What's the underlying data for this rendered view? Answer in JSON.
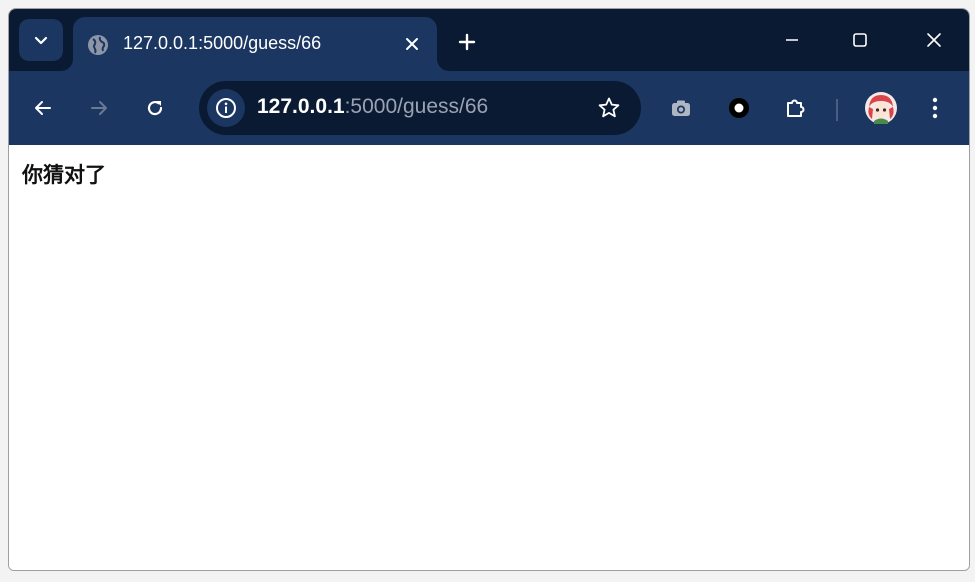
{
  "browser": {
    "tab": {
      "title": "127.0.0.1:5000/guess/66",
      "favicon": "globe-icon"
    },
    "window_controls": [
      "minimize-icon",
      "maximize-icon",
      "close-icon"
    ],
    "address_bar": {
      "host": "127.0.0.1",
      "path": ":5000/guess/66"
    },
    "toolbar_icons": [
      "back-icon",
      "forward-icon",
      "reload-icon",
      "site-info-icon",
      "bookmark-star-icon",
      "camera-extension-icon",
      "circle-extension-icon",
      "extensions-puzzle-icon",
      "profile-avatar",
      "more-menu-icon"
    ],
    "colors": {
      "titlebar": "#0b1a33",
      "toolbar": "#1b3660",
      "omnibox": "#0b1a33"
    }
  },
  "page": {
    "body_text": "你猜对了"
  }
}
